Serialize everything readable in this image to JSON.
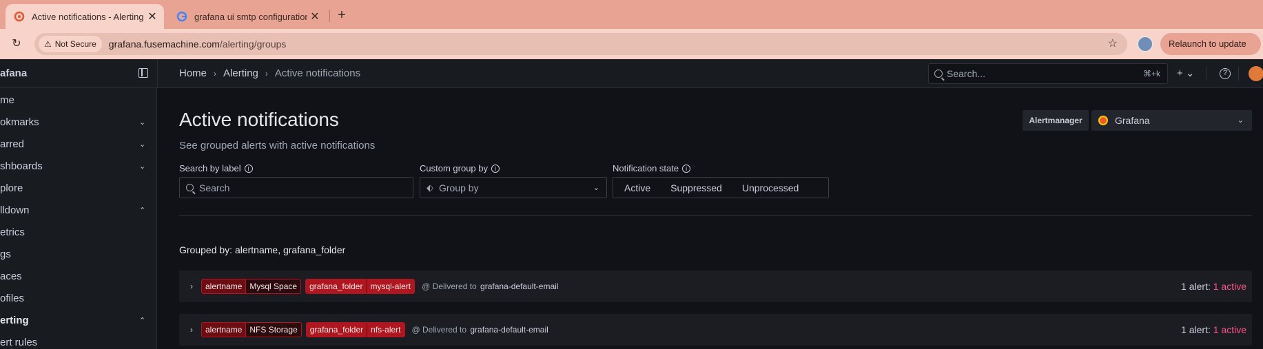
{
  "browser": {
    "tabs": [
      {
        "title": "Active notifications - Alerting",
        "close": "✕"
      },
      {
        "title": "grafana ui smtp configuration",
        "close": "✕"
      }
    ],
    "new_tab": "+",
    "security_label": "Not Secure",
    "url_host": "grafana.fusemachine.com",
    "url_path": "/alerting/groups",
    "relaunch_label": "Relaunch to update"
  },
  "topbar": {
    "brand": "afana",
    "breadcrumbs": [
      "Home",
      "Alerting",
      "Active notifications"
    ],
    "search_placeholder": "Search...",
    "search_shortcut": "⌘+k",
    "plus_label": "+ ⌄",
    "help_label": "?"
  },
  "sidebar": {
    "items": [
      {
        "label": "me",
        "chevron": ""
      },
      {
        "label": "okmarks",
        "chevron": "⌄"
      },
      {
        "label": "arred",
        "chevron": "⌄"
      },
      {
        "label": "shboards",
        "chevron": "⌄"
      },
      {
        "label": "plore",
        "chevron": ""
      },
      {
        "label": "lldown",
        "chevron": "⌃"
      },
      {
        "label": "etrics",
        "chevron": ""
      },
      {
        "label": "gs",
        "chevron": ""
      },
      {
        "label": "aces",
        "chevron": ""
      },
      {
        "label": "ofiles",
        "chevron": ""
      },
      {
        "label": "erting",
        "chevron": "⌃"
      },
      {
        "label": "ert rules",
        "chevron": ""
      }
    ]
  },
  "main": {
    "title": "Active notifications",
    "subtitle": "See grouped alerts with active notifications",
    "alertmanager_label": "Alertmanager",
    "alertmanager_value": "Grafana",
    "filters": {
      "search_label": "Search by label",
      "search_placeholder": "Search",
      "group_label": "Custom group by",
      "group_placeholder": "Group by",
      "state_label": "Notification state",
      "state_options": [
        "Active",
        "Suppressed",
        "Unprocessed"
      ]
    },
    "grouped_by": "Grouped by: alertname, grafana_folder",
    "groups": [
      {
        "labels": [
          {
            "key": "alertname",
            "value": "Mysql Space"
          },
          {
            "key": "grafana_folder",
            "value": "mysql-alert"
          }
        ],
        "delivered_prefix": "@ Delivered to",
        "receiver": "grafana-default-email",
        "count_prefix": "1 alert:",
        "count_active": "1 active"
      },
      {
        "labels": [
          {
            "key": "alertname",
            "value": "NFS Storage"
          },
          {
            "key": "grafana_folder",
            "value": "nfs-alert"
          }
        ],
        "delivered_prefix": "@ Delivered to",
        "receiver": "grafana-default-email",
        "count_prefix": "1 alert:",
        "count_active": "1 active"
      }
    ]
  },
  "colors": {
    "accent_active": "#ff5286",
    "label_red": "#b0161f",
    "chrome": "#e8a393"
  }
}
